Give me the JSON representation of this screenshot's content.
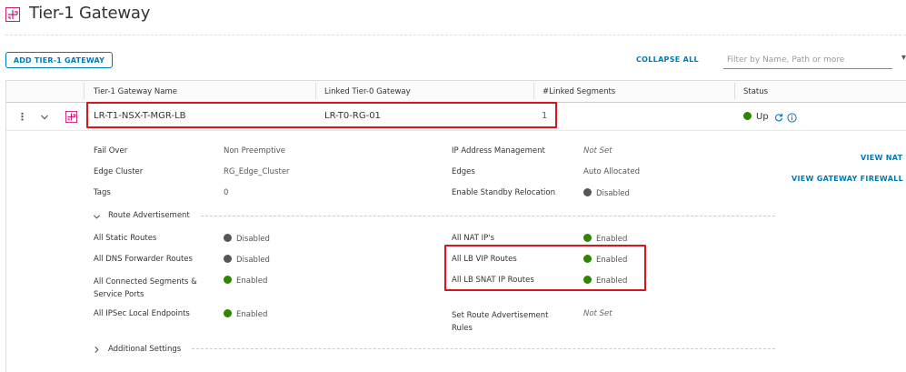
{
  "page": {
    "title": "Tier-1 Gateway"
  },
  "toolbar": {
    "add_label": "ADD TIER-1 GATEWAY",
    "collapse_label": "COLLAPSE ALL",
    "filter_placeholder": "Filter by Name, Path or more"
  },
  "table": {
    "headers": [
      "Tier-1 Gateway Name",
      "Linked Tier-0 Gateway",
      "#Linked Segments",
      "Status"
    ],
    "row": {
      "name": "LR-T1-NSX-T-MGR-LB",
      "tier0": "LR-T0-RG-01",
      "segments": "1",
      "status": "Up"
    }
  },
  "details": {
    "fail_over": {
      "label": "Fail Over",
      "value": "Non Preemptive"
    },
    "edge_cluster": {
      "label": "Edge Cluster",
      "value": "RG_Edge_Cluster"
    },
    "tags": {
      "label": "Tags",
      "value": "0"
    },
    "ip_mgmt": {
      "label": "IP Address Management",
      "value": "Not Set"
    },
    "edges": {
      "label": "Edges",
      "value": "Auto Allocated"
    },
    "standby": {
      "label": "Enable Standby Relocation",
      "value": "Disabled"
    }
  },
  "route_adv": {
    "title": "Route Advertisement",
    "static_routes": {
      "label": "All Static Routes",
      "value": "Disabled"
    },
    "dns_fwd": {
      "label": "All DNS Forwarder Routes",
      "value": "Disabled"
    },
    "connected_segments": {
      "label_line1": "All Connected Segments &",
      "label_line2": "Service Ports",
      "value": "Enabled"
    },
    "ipsec": {
      "label": "All IPSec Local Endpoints",
      "value": "Enabled"
    },
    "nat_ips": {
      "label": "All NAT IP's",
      "value": "Enabled"
    },
    "lb_vip": {
      "label": "All LB VIP Routes",
      "value": "Enabled"
    },
    "lb_snat": {
      "label": "All LB SNAT IP Routes",
      "value": "Enabled"
    },
    "set_rules": {
      "label_line1": "Set Route Advertisement",
      "label_line2": "Rules",
      "value": "Not Set"
    }
  },
  "additional": {
    "title": "Additional Settings"
  },
  "side_links": {
    "view_nat": "VIEW NAT",
    "view_firewall": "VIEW GATEWAY FIREWALL"
  },
  "colors": {
    "accent": "#0079b8",
    "highlight": "#d9141c",
    "enabled": "#2f8400",
    "disabled": "#565656",
    "brand_icon": "#c21d73"
  }
}
